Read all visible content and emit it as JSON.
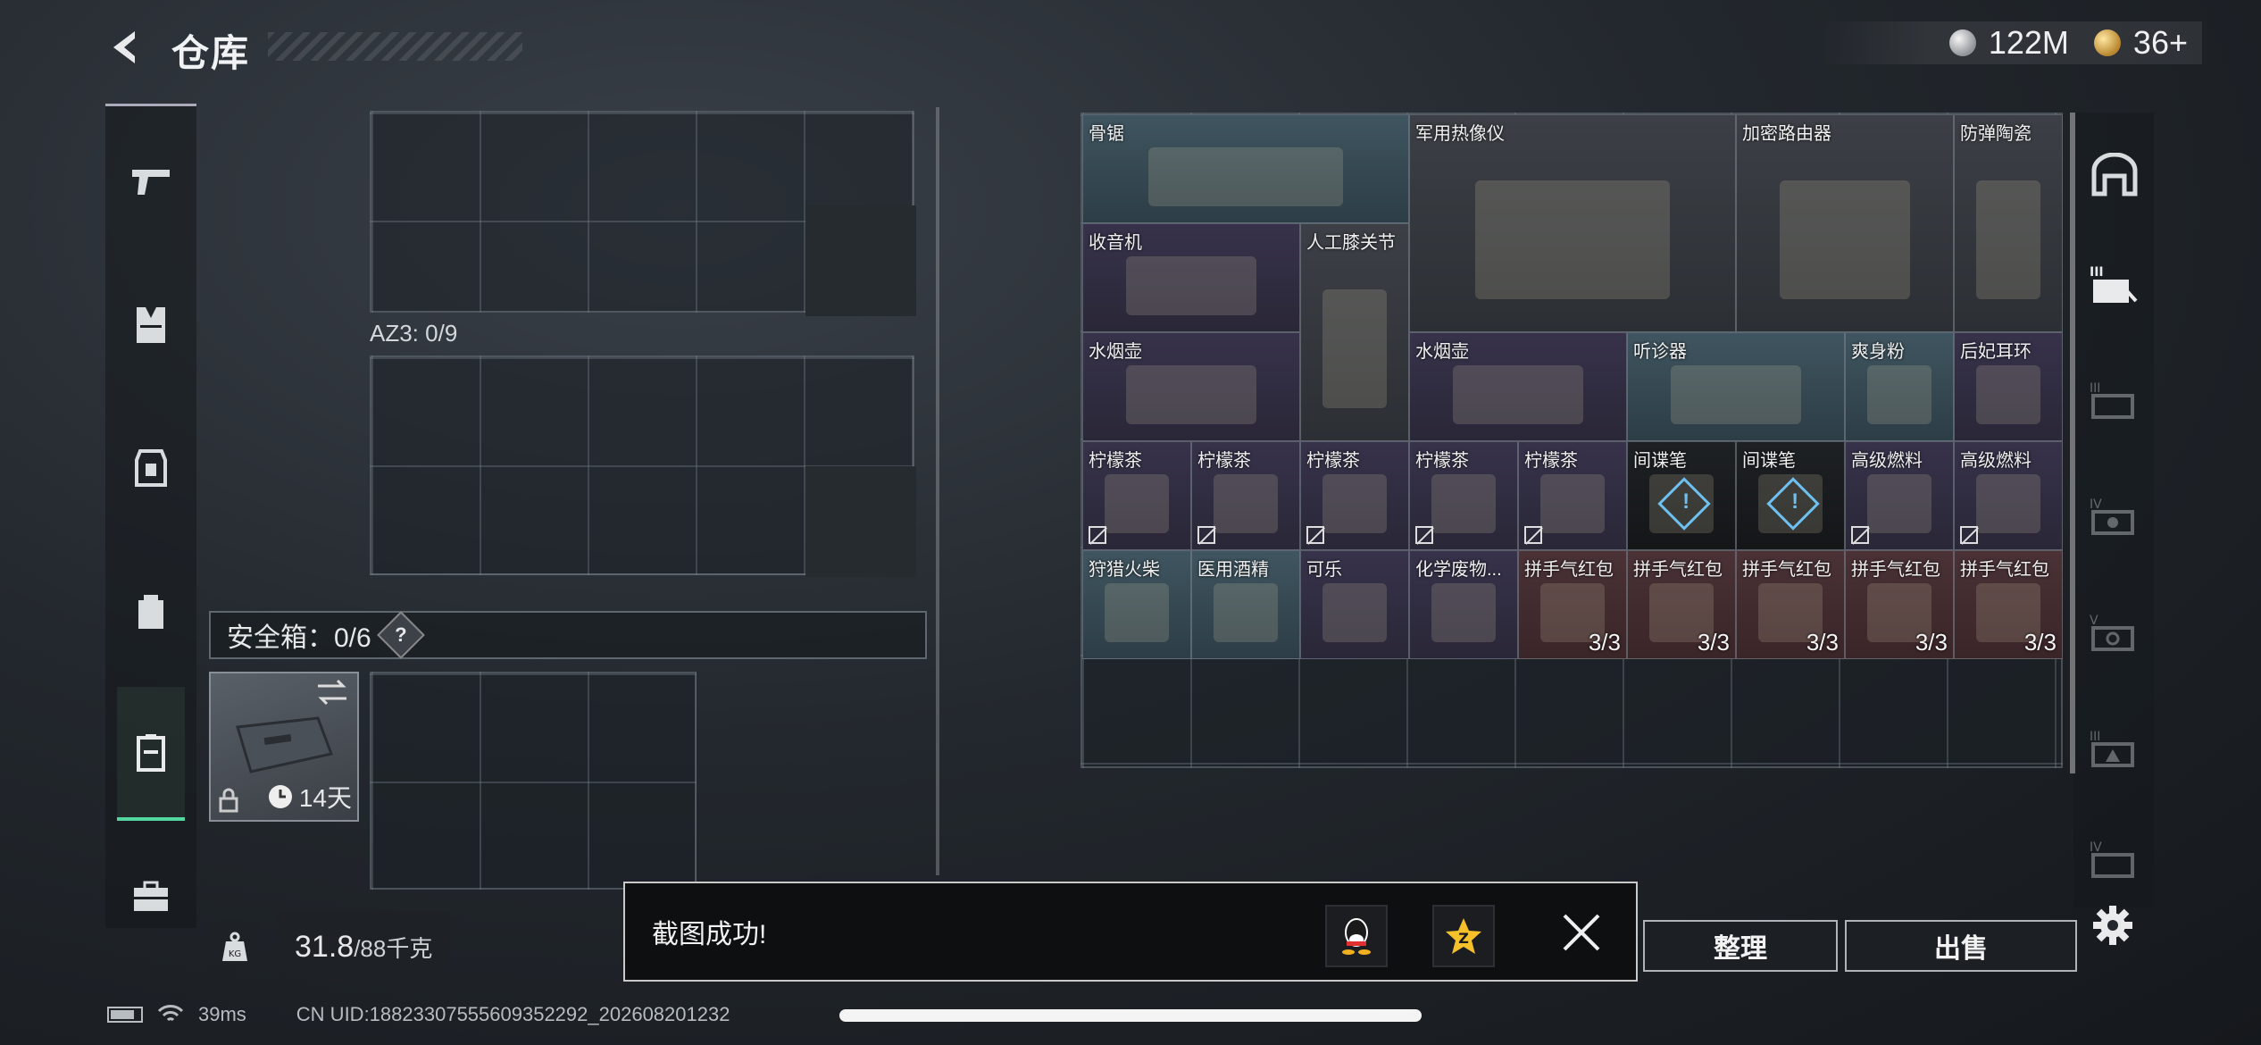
{
  "header": {
    "title": "仓库"
  },
  "currency": {
    "coins": "122M",
    "tokens": "36+"
  },
  "left_nav": {
    "items": [
      "pistol-icon",
      "vest-icon",
      "armor-icon",
      "backpack-icon",
      "safe-case-icon",
      "briefcase-icon"
    ],
    "active": 4
  },
  "containers": {
    "az3_label": "AZ3: 0/9",
    "safe_box_label": "安全箱：0/6",
    "safe_box_help": "?",
    "safe_case_time": "14天"
  },
  "weight": {
    "current": "31.8",
    "max": "/88千克",
    "icon_label": "KG"
  },
  "inventory": {
    "items": [
      {
        "name": "骨锯",
        "color": "blue"
      },
      {
        "name": "军用热像仪",
        "color": "gray"
      },
      {
        "name": "加密路由器",
        "color": "gray"
      },
      {
        "name": "防弹陶瓷",
        "color": "gray"
      },
      {
        "name": "收音机",
        "color": "purple"
      },
      {
        "name": "人工膝关节",
        "color": "gray"
      },
      {
        "name": "水烟壶",
        "color": "purple"
      },
      {
        "name": "水烟壶",
        "color": "purple"
      },
      {
        "name": "听诊器",
        "color": "blue"
      },
      {
        "name": "爽身粉",
        "color": "blue"
      },
      {
        "name": "后妃耳环",
        "color": "purple"
      },
      {
        "name": "柠檬茶",
        "color": "purple",
        "locked": true
      },
      {
        "name": "柠檬茶",
        "color": "purple",
        "locked": true
      },
      {
        "name": "柠檬茶",
        "color": "purple",
        "locked": true
      },
      {
        "name": "柠檬茶",
        "color": "purple",
        "locked": true
      },
      {
        "name": "柠檬茶",
        "color": "purple",
        "locked": true
      },
      {
        "name": "间谍笔",
        "color": "black"
      },
      {
        "name": "间谍笔",
        "color": "black"
      },
      {
        "name": "高级燃料",
        "color": "purple",
        "locked": true
      },
      {
        "name": "高级燃料",
        "color": "purple",
        "locked": true
      },
      {
        "name": "狩猎火柴",
        "color": "blue"
      },
      {
        "name": "医用酒精",
        "color": "blue"
      },
      {
        "name": "可乐",
        "color": "purple"
      },
      {
        "name": "化学废物...",
        "color": "purple"
      },
      {
        "name": "拼手气红包",
        "color": "red",
        "count": "3/3"
      },
      {
        "name": "拼手气红包",
        "color": "red",
        "count": "3/3"
      },
      {
        "name": "拼手气红包",
        "color": "red",
        "count": "3/3"
      },
      {
        "name": "拼手气红包",
        "color": "red",
        "count": "3/3"
      },
      {
        "name": "拼手气红包",
        "color": "red",
        "count": "3/3"
      }
    ]
  },
  "right_nav": {
    "items": [
      "armory-icon",
      "tier-ii-icon",
      "tier-iii-icon",
      "tier-iv-icon",
      "tier-v-icon",
      "tier-iii-b-icon",
      "tier-iv-b-icon"
    ],
    "settings": "gear-icon"
  },
  "toast": {
    "message": "截图成功!"
  },
  "actions": {
    "sort": "整理",
    "sell": "出售"
  },
  "status": {
    "ping": "39ms",
    "uid": "CN UID:18823307555609352292_202608201232"
  }
}
